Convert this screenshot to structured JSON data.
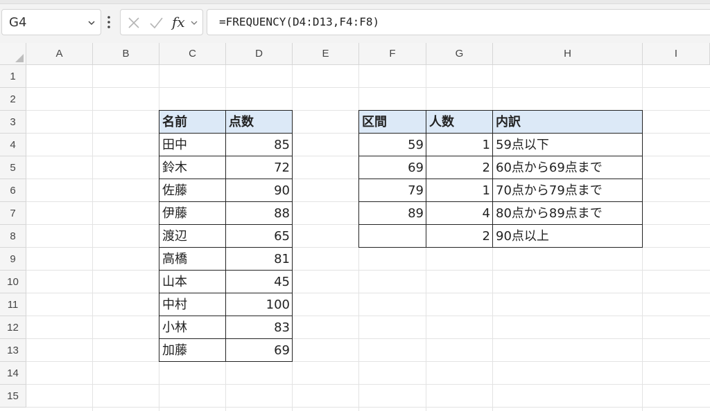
{
  "formula_bar": {
    "name_box": "G4",
    "cancel_icon": "x-icon",
    "enter_icon": "check-icon",
    "fx_label": "fx",
    "formula": "=FREQUENCY(D4:D13,F4:F8)"
  },
  "columns": [
    "A",
    "B",
    "C",
    "D",
    "E",
    "F",
    "G",
    "H",
    "I"
  ],
  "rows": [
    "1",
    "2",
    "3",
    "4",
    "5",
    "6",
    "7",
    "8",
    "9",
    "10",
    "11",
    "12",
    "13",
    "14",
    "15"
  ],
  "scores_table": {
    "headers": {
      "name": "名前",
      "score": "点数"
    },
    "rows": [
      {
        "name": "田中",
        "score": "85"
      },
      {
        "name": "鈴木",
        "score": "72"
      },
      {
        "name": "佐藤",
        "score": "90"
      },
      {
        "name": "伊藤",
        "score": "88"
      },
      {
        "name": "渡辺",
        "score": "65"
      },
      {
        "name": "高橋",
        "score": "81"
      },
      {
        "name": "山本",
        "score": "45"
      },
      {
        "name": "中村",
        "score": "100"
      },
      {
        "name": "小林",
        "score": "83"
      },
      {
        "name": "加藤",
        "score": "69"
      }
    ]
  },
  "frequency_table": {
    "headers": {
      "bin": "区間",
      "count": "人数",
      "detail": "内訳"
    },
    "rows": [
      {
        "bin": "59",
        "count": "1",
        "detail": "59点以下"
      },
      {
        "bin": "69",
        "count": "2",
        "detail": "60点から69点まで"
      },
      {
        "bin": "79",
        "count": "1",
        "detail": "70点から79点まで"
      },
      {
        "bin": "89",
        "count": "4",
        "detail": "80点から89点まで"
      },
      {
        "bin": "",
        "count": "2",
        "detail": "90点以上"
      }
    ]
  },
  "colors": {
    "header_fill": "#dce9f7",
    "grid_line": "#e3e3e3",
    "header_bg": "#f5f5f5"
  }
}
